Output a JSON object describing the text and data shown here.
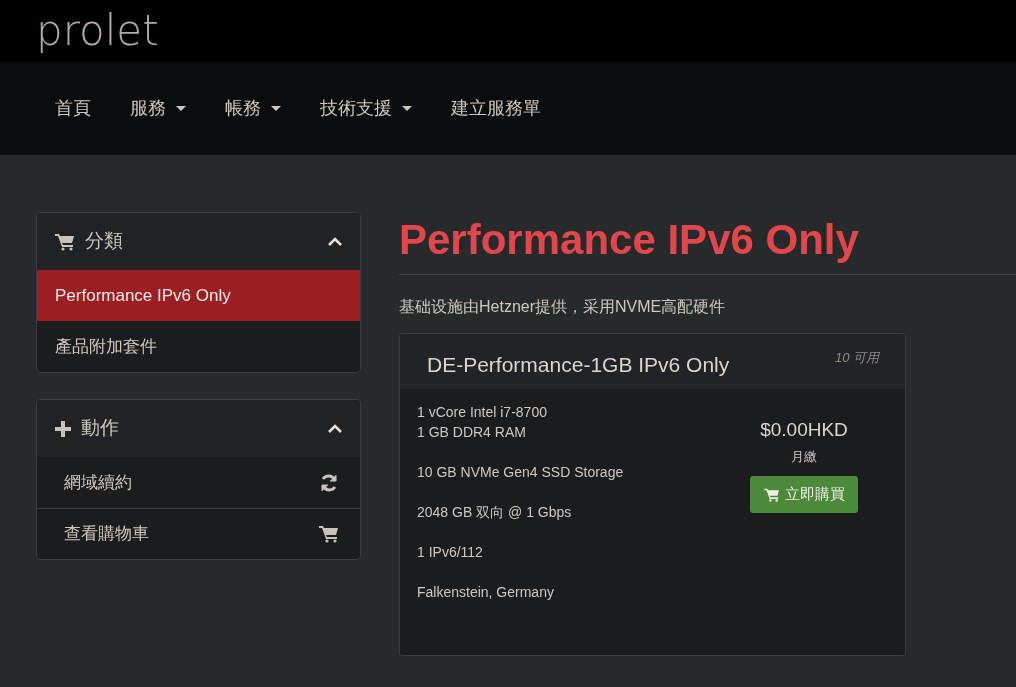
{
  "brand": {
    "logo": "prolet"
  },
  "nav": [
    {
      "label": "首頁",
      "dropdown": false
    },
    {
      "label": "服務",
      "dropdown": true
    },
    {
      "label": "帳務",
      "dropdown": true
    },
    {
      "label": "技術支援",
      "dropdown": true
    },
    {
      "label": "建立服務單",
      "dropdown": false
    }
  ],
  "sidebar": [
    {
      "title": "分類",
      "kind": "cart",
      "expanded": true,
      "items": [
        {
          "label": "Performance IPv6 Only",
          "selected": true
        },
        {
          "label": "產品附加套件",
          "selected": false
        }
      ]
    },
    {
      "title": "動作",
      "kind": "plus",
      "expanded": true,
      "items": [
        {
          "label": "網域續約",
          "kind": "refresh"
        },
        {
          "label": "查看購物車",
          "kind": "cart"
        }
      ]
    }
  ],
  "main": {
    "title": "Performance IPv6 Only",
    "subtitle": "基础设施由Hetzner提供，采用NVME高配硬件",
    "products": [
      {
        "name": "DE-Performance-1GB IPv6 Only",
        "availability": "10 可用",
        "features": [
          [
            "1 vCore Intel i7-8700",
            "1 GB DDR4 RAM"
          ],
          [
            "10 GB NVMe Gen4 SSD Storage"
          ],
          [
            "2048 GB 双向 @ 1 Gbps"
          ],
          [
            "1 IPv6/112"
          ],
          [
            "Falkenstein, Germany"
          ]
        ],
        "price": "$0.00HKD",
        "cycle": "月繳",
        "button": "立即購買"
      }
    ]
  }
}
